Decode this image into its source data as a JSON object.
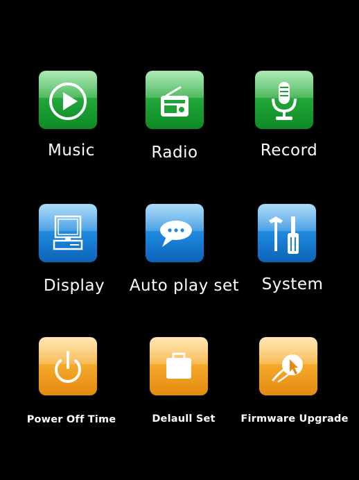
{
  "menu": {
    "items": [
      {
        "label": "Music",
        "icon": "play-icon",
        "color": "#1fa336"
      },
      {
        "label": "Radio",
        "icon": "radio-icon",
        "color": "#1fa336"
      },
      {
        "label": "Record",
        "icon": "microphone-icon",
        "color": "#1fa336"
      },
      {
        "label": "Display",
        "icon": "monitor-icon",
        "color": "#1c86db"
      },
      {
        "label": "Auto play set",
        "icon": "speech-bubble-icon",
        "color": "#1c86db"
      },
      {
        "label": "System",
        "icon": "tools-icon",
        "color": "#1c86db"
      },
      {
        "label": "Power Off Time",
        "icon": "power-icon",
        "color": "#f3a526"
      },
      {
        "label": "Delaull Set",
        "icon": "briefcase-icon",
        "color": "#f3a526"
      },
      {
        "label": "Firmware Upgrade",
        "icon": "upgrade-arrow-icon",
        "color": "#f3a526"
      }
    ]
  }
}
